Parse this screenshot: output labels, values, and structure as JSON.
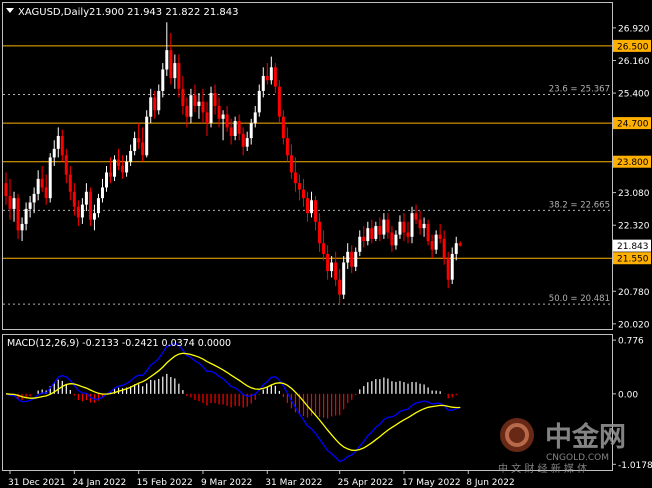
{
  "header": {
    "symbol": "XAGUSD,Daily",
    "ohlc": "21.900 21.943 21.822 21.843"
  },
  "macd_header": "MACD(12,26,9) -0.2133 -0.2421 0.0374 0.0000",
  "colors": {
    "background": "#000000",
    "frame": "#c0c0c0",
    "bull": "#ffffff",
    "bear": "#ff0000",
    "level_line": "#ffb000",
    "fib_line": "#b0b0b0",
    "level_label_bg": "#ffb000",
    "price_label_bg": "#ffffff",
    "macd_hist_pos": "#ffffff",
    "macd_hist_neg": "#ff0000",
    "macd_line": "#0000ff",
    "signal_line": "#ffff00",
    "text": "#ffffff"
  },
  "watermark": {
    "brand": "中金网",
    "domain": "CNGOLD.COM",
    "slogan": "中 文 财 经 新 媒 体"
  },
  "chart_data": [
    {
      "type": "candlestick",
      "series": [
        {
          "name": "XAGUSD,Daily"
        }
      ],
      "y_ticks": [
        26.92,
        26.16,
        25.4,
        24.64,
        23.84,
        23.08,
        22.32,
        21.56,
        20.78,
        20.02
      ],
      "ylim": [
        19.9,
        27.5
      ],
      "x_labels": [
        "31 Dec 2021",
        "24 Jan 2022",
        "15 Feb 2022",
        "9 Mar 2022",
        "31 Mar 2022",
        "25 Apr 2022",
        "17 May 2022",
        "8 Jun 2022"
      ],
      "x_label_index": [
        1,
        17,
        33,
        49,
        65,
        83,
        99,
        115
      ],
      "current_price": 21.843,
      "levels": [
        26.5,
        24.7,
        23.8,
        21.55
      ],
      "fibs": [
        {
          "label": "23.6 = 25.367",
          "value": 25.367
        },
        {
          "label": "38.2 = 22.665",
          "value": 22.665
        },
        {
          "label": "50.0 = 20.481",
          "value": 20.481
        }
      ],
      "candles": [
        [
          23.3,
          23.55,
          22.8,
          23.0
        ],
        [
          23.0,
          23.4,
          22.45,
          22.7
        ],
        [
          22.7,
          23.1,
          22.4,
          22.95
        ],
        [
          22.95,
          23.05,
          22.0,
          22.2
        ],
        [
          22.2,
          22.5,
          21.95,
          22.35
        ],
        [
          22.35,
          22.85,
          22.2,
          22.7
        ],
        [
          22.7,
          23.0,
          22.5,
          22.85
        ],
        [
          22.85,
          23.2,
          22.6,
          23.05
        ],
        [
          23.05,
          23.6,
          22.9,
          23.4
        ],
        [
          23.4,
          23.7,
          23.1,
          23.2
        ],
        [
          23.2,
          23.5,
          22.8,
          22.95
        ],
        [
          22.95,
          24.0,
          22.85,
          23.9
        ],
        [
          23.9,
          24.3,
          23.7,
          24.1
        ],
        [
          24.1,
          24.6,
          23.9,
          24.4
        ],
        [
          24.4,
          24.55,
          23.8,
          23.95
        ],
        [
          23.95,
          24.1,
          23.3,
          23.5
        ],
        [
          23.5,
          23.7,
          22.9,
          23.1
        ],
        [
          23.1,
          23.3,
          22.55,
          22.75
        ],
        [
          22.75,
          22.9,
          22.3,
          22.5
        ],
        [
          22.5,
          22.95,
          22.35,
          22.8
        ],
        [
          22.8,
          23.3,
          22.65,
          23.1
        ],
        [
          23.1,
          23.2,
          22.3,
          22.45
        ],
        [
          22.45,
          22.8,
          22.2,
          22.6
        ],
        [
          22.6,
          23.05,
          22.5,
          22.95
        ],
        [
          22.95,
          23.4,
          22.85,
          23.2
        ],
        [
          23.2,
          23.7,
          23.1,
          23.55
        ],
        [
          23.55,
          23.9,
          23.3,
          23.45
        ],
        [
          23.45,
          23.95,
          23.35,
          23.85
        ],
        [
          23.85,
          24.1,
          23.6,
          23.7
        ],
        [
          23.7,
          23.95,
          23.4,
          23.55
        ],
        [
          23.55,
          23.95,
          23.45,
          23.8
        ],
        [
          23.8,
          24.2,
          23.7,
          24.05
        ],
        [
          24.05,
          24.5,
          23.95,
          24.35
        ],
        [
          24.35,
          24.7,
          24.1,
          24.25
        ],
        [
          24.25,
          24.6,
          23.8,
          23.95
        ],
        [
          23.95,
          25.0,
          23.9,
          24.85
        ],
        [
          24.85,
          25.5,
          24.7,
          25.3
        ],
        [
          25.3,
          25.45,
          24.8,
          25.0
        ],
        [
          25.0,
          25.6,
          24.9,
          25.45
        ],
        [
          25.45,
          26.1,
          25.3,
          25.95
        ],
        [
          25.95,
          27.05,
          25.8,
          26.4
        ],
        [
          26.4,
          26.8,
          25.6,
          25.75
        ],
        [
          25.75,
          26.3,
          25.5,
          26.1
        ],
        [
          26.1,
          26.3,
          25.3,
          25.5
        ],
        [
          25.5,
          25.8,
          24.9,
          25.1
        ],
        [
          25.1,
          25.3,
          24.6,
          24.85
        ],
        [
          24.85,
          25.5,
          24.7,
          25.35
        ],
        [
          25.35,
          25.6,
          24.95,
          25.1
        ],
        [
          25.1,
          25.4,
          24.8,
          25.2
        ],
        [
          25.2,
          25.5,
          24.7,
          24.95
        ],
        [
          24.95,
          25.2,
          24.4,
          24.7
        ],
        [
          24.7,
          25.55,
          24.6,
          25.4
        ],
        [
          25.4,
          25.6,
          24.9,
          25.1
        ],
        [
          25.1,
          25.3,
          24.6,
          24.8
        ],
        [
          24.8,
          25.0,
          24.3,
          24.9
        ],
        [
          24.9,
          25.1,
          24.5,
          24.6
        ],
        [
          24.6,
          24.8,
          24.2,
          24.4
        ],
        [
          24.4,
          24.85,
          24.3,
          24.75
        ],
        [
          24.75,
          24.9,
          24.3,
          24.45
        ],
        [
          24.45,
          24.6,
          23.95,
          24.15
        ],
        [
          24.15,
          24.5,
          24.05,
          24.35
        ],
        [
          24.35,
          24.8,
          24.2,
          24.7
        ],
        [
          24.7,
          25.1,
          24.6,
          24.95
        ],
        [
          24.95,
          25.6,
          24.85,
          25.45
        ],
        [
          25.45,
          26.0,
          25.3,
          25.8
        ],
        [
          25.8,
          26.1,
          25.6,
          25.7
        ],
        [
          25.7,
          26.25,
          25.6,
          26.0
        ],
        [
          26.0,
          26.1,
          25.4,
          25.55
        ],
        [
          25.55,
          25.7,
          24.7,
          24.85
        ],
        [
          24.85,
          25.0,
          24.2,
          24.35
        ],
        [
          24.35,
          24.6,
          23.8,
          23.95
        ],
        [
          23.95,
          24.2,
          23.4,
          23.55
        ],
        [
          23.55,
          23.9,
          23.1,
          23.3
        ],
        [
          23.3,
          23.5,
          22.9,
          23.15
        ],
        [
          23.15,
          23.4,
          22.75,
          22.95
        ],
        [
          22.95,
          23.1,
          22.4,
          22.6
        ],
        [
          22.6,
          23.1,
          22.5,
          22.9
        ],
        [
          22.9,
          23.0,
          22.2,
          22.4
        ],
        [
          22.4,
          22.6,
          21.7,
          21.9
        ],
        [
          21.9,
          22.2,
          21.5,
          21.65
        ],
        [
          21.65,
          21.85,
          21.05,
          21.25
        ],
        [
          21.25,
          21.6,
          21.1,
          21.45
        ],
        [
          21.45,
          21.7,
          20.9,
          21.05
        ],
        [
          21.05,
          21.3,
          20.5,
          20.7
        ],
        [
          20.7,
          21.6,
          20.6,
          21.45
        ],
        [
          21.45,
          21.9,
          21.3,
          21.7
        ],
        [
          21.7,
          21.85,
          21.2,
          21.35
        ],
        [
          21.35,
          21.8,
          21.25,
          21.7
        ],
        [
          21.7,
          22.2,
          21.6,
          22.05
        ],
        [
          22.05,
          22.3,
          21.8,
          21.95
        ],
        [
          21.95,
          22.4,
          21.85,
          22.25
        ],
        [
          22.25,
          22.45,
          21.9,
          22.0
        ],
        [
          22.0,
          22.4,
          21.95,
          22.3
        ],
        [
          22.3,
          22.5,
          21.95,
          22.1
        ],
        [
          22.1,
          22.6,
          22.0,
          22.45
        ],
        [
          22.45,
          22.6,
          22.0,
          22.15
        ],
        [
          22.15,
          22.3,
          21.7,
          21.85
        ],
        [
          21.85,
          22.2,
          21.75,
          22.1
        ],
        [
          22.1,
          22.55,
          22.0,
          22.4
        ],
        [
          22.4,
          22.6,
          21.95,
          22.15
        ],
        [
          22.15,
          22.4,
          21.9,
          22.05
        ],
        [
          22.05,
          22.75,
          21.9,
          22.6
        ],
        [
          22.6,
          22.8,
          22.35,
          22.45
        ],
        [
          22.45,
          22.65,
          22.1,
          22.25
        ],
        [
          22.25,
          22.5,
          22.05,
          22.35
        ],
        [
          22.35,
          22.45,
          21.85,
          21.95
        ],
        [
          21.95,
          22.1,
          21.55,
          21.75
        ],
        [
          21.75,
          22.2,
          21.65,
          22.1
        ],
        [
          22.1,
          22.35,
          21.9,
          22.0
        ],
        [
          22.0,
          22.2,
          21.4,
          21.55
        ],
        [
          21.55,
          21.7,
          20.85,
          21.05
        ],
        [
          21.05,
          21.8,
          20.95,
          21.65
        ],
        [
          21.65,
          22.05,
          21.5,
          21.9
        ],
        [
          21.9,
          21.943,
          21.822,
          21.843
        ]
      ]
    },
    {
      "type": "macd",
      "series": [
        {
          "name": "MACD(12,26,9)"
        }
      ],
      "y_ticks": [
        0.776,
        0.0,
        -1.0178
      ],
      "ylim": [
        -1.1,
        0.85
      ],
      "values": {
        "main": -0.2133,
        "signal": -0.2421,
        "histogram": 0.0374,
        "extra": 0.0
      }
    }
  ]
}
